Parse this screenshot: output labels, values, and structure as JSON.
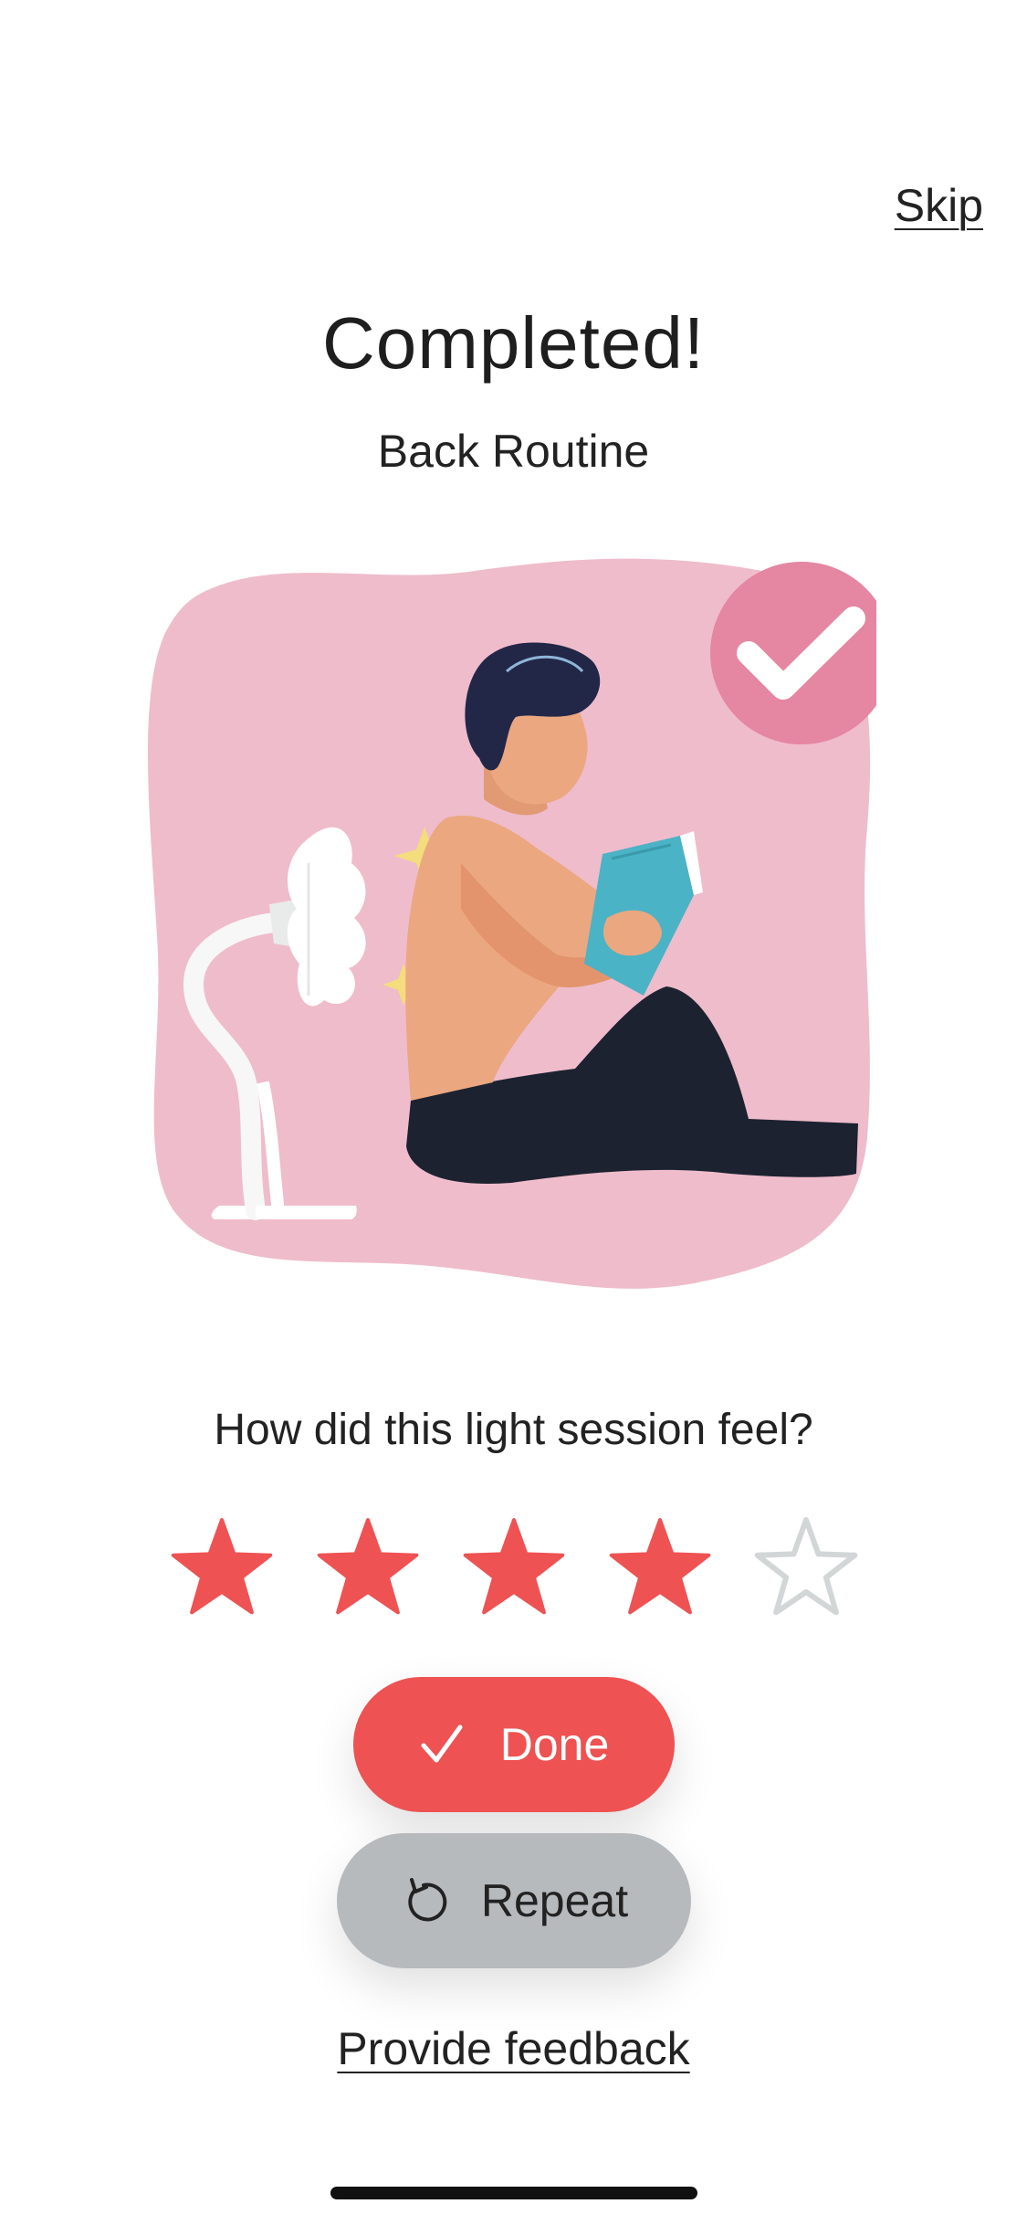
{
  "header": {
    "skip_label": "Skip"
  },
  "main": {
    "title": "Completed!",
    "subtitle": "Back Routine",
    "question": "How did this light session feel?"
  },
  "rating": {
    "value": 4,
    "max": 5,
    "filled_color": "#ee5252",
    "empty_color": "#d2d6d6"
  },
  "actions": {
    "done_label": "Done",
    "done_icon": "checkmark-icon",
    "repeat_label": "Repeat",
    "repeat_icon": "repeat-icon",
    "feedback_label": "Provide feedback"
  },
  "colors": {
    "accent": "#ee5252",
    "illustration_bg": "#efbccb",
    "badge": "#e586a3",
    "secondary_button": "#b7babd"
  }
}
